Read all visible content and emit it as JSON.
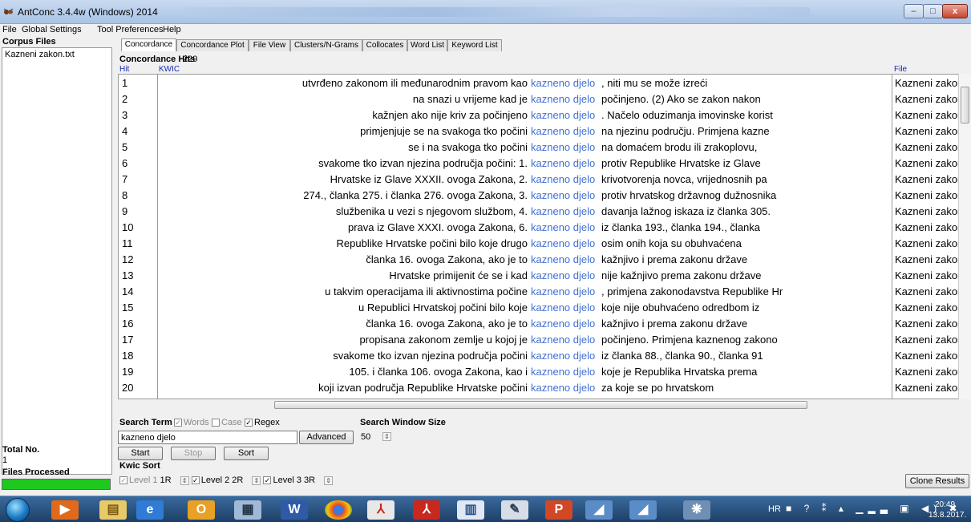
{
  "window": {
    "title": "AntConc 3.4.4w (Windows) 2014",
    "minimize": "–",
    "maximize": "□",
    "close": "x"
  },
  "menu": [
    "File",
    "Global Settings",
    "Tool Preferences",
    "Help"
  ],
  "left_panel": {
    "corpus_title": "Corpus Files",
    "files": [
      "Kazneni zakon.txt"
    ],
    "total_label": "Total No.",
    "total_value": "1",
    "files_processed_label": "Files Processed",
    "progress": 1.0
  },
  "tabs": [
    "Concordance",
    "Concordance Plot",
    "File View",
    "Clusters/N-Grams",
    "Collocates",
    "Word List",
    "Keyword List"
  ],
  "active_tab": "Concordance",
  "hits": {
    "label": "Concordance Hits",
    "count": "229"
  },
  "columns": {
    "hit": "Hit",
    "kwic": "KWIC",
    "file": "File"
  },
  "rows": [
    {
      "hit": "1",
      "left": "utvrđeno zakonom ili međunarodnim pravom kao",
      "kw": "kazneno djelo",
      "right": ", niti mu se može izreći",
      "file": "Kazneni zakon"
    },
    {
      "hit": "2",
      "left": "na snazi u vrijeme kad je",
      "kw": "kazneno djelo",
      "right": " počinjeno. (2) Ako se zakon nakon",
      "file": "Kazneni zakon"
    },
    {
      "hit": "3",
      "left": "kažnjen ako nije kriv za počinjeno",
      "kw": "kazneno djelo",
      "right": ".  Načelo oduzimanja imovinske korist",
      "file": "Kazneni zakon"
    },
    {
      "hit": "4",
      "left": "primjenjuje se na svakoga tko počini",
      "kw": "kazneno djelo",
      "right": " na njezinu području.  Primjena kazne",
      "file": "Kazneni zakon"
    },
    {
      "hit": "5",
      "left": "se i na svakoga tko počini",
      "kw": "kazneno djelo",
      "right": " na domaćem brodu ili zrakoplovu,",
      "file": "Kazneni zakon"
    },
    {
      "hit": "6",
      "left": "svakome tko izvan njezina područja počini: 1.",
      "kw": "kazneno djelo",
      "right": " protiv Republike Hrvatske iz Glave",
      "file": "Kazneni zakon"
    },
    {
      "hit": "7",
      "left": "Hrvatske iz Glave XXXII. ovoga Zakona, 2.",
      "kw": "kazneno djelo",
      "right": " krivotvorenja novca, vrijednosnih pa",
      "file": "Kazneni zakon"
    },
    {
      "hit": "8",
      "left": "274., članka 275. i članka 276. ovoga Zakona, 3.",
      "kw": "kazneno djelo",
      "right": " protiv hrvatskog državnog dužnosnika",
      "file": "Kazneni zakon"
    },
    {
      "hit": "9",
      "left": "službenika u vezi s njegovom službom, 4.",
      "kw": "kazneno djelo",
      "right": " davanja lažnog iskaza iz članka 305.",
      "file": "Kazneni zakon"
    },
    {
      "hit": "10",
      "left": "prava iz Glave XXXI. ovoga Zakona, 6.",
      "kw": "kazneno djelo",
      "right": " iz članka 193., članka 194., članka",
      "file": "Kazneni zakon"
    },
    {
      "hit": "11",
      "left": "Republike Hrvatske počini bilo koje drugo",
      "kw": "kazneno djelo",
      "right": " osim onih koja su obuhvaćena",
      "file": "Kazneni zakon"
    },
    {
      "hit": "12",
      "left": "članka 16. ovoga Zakona, ako je to",
      "kw": "kazneno djelo",
      "right": " kažnjivo i prema zakonu države",
      "file": "Kazneni zakon"
    },
    {
      "hit": "13",
      "left": "Hrvatske primijenit će se i kad",
      "kw": "kazneno djelo",
      "right": " nije kažnjivo prema zakonu države",
      "file": "Kazneni zakon"
    },
    {
      "hit": "14",
      "left": "u takvim operacijama ili aktivnostima počine",
      "kw": "kazneno djelo",
      "right": ", primjena zakonodavstva Republike Hr",
      "file": "Kazneni zakon"
    },
    {
      "hit": "15",
      "left": "u Republici Hrvatskoj počini bilo koje",
      "kw": "kazneno djelo",
      "right": " koje nije obuhvaćeno odredbom iz",
      "file": "Kazneni zakon"
    },
    {
      "hit": "16",
      "left": "članka 16. ovoga Zakona, ako je to",
      "kw": "kazneno djelo",
      "right": " kažnjivo i prema zakonu države",
      "file": "Kazneni zakon"
    },
    {
      "hit": "17",
      "left": "propisana zakonom zemlje u kojoj je",
      "kw": "kazneno djelo",
      "right": " počinjeno.  Primjena kaznenog zakono",
      "file": "Kazneni zakon"
    },
    {
      "hit": "18",
      "left": "svakome tko izvan njezina područja počini",
      "kw": "kazneno djelo",
      "right": " iz članka 88., članka 90., članka 91",
      "file": "Kazneni zakon"
    },
    {
      "hit": "19",
      "left": "105. i članka 106. ovoga Zakona, kao i",
      "kw": "kazneno djelo",
      "right": " koje je Republika Hrvatska prema",
      "file": "Kazneni zakon"
    },
    {
      "hit": "20",
      "left": "koji izvan područja Republike Hrvatske počini",
      "kw": "kazneno djelo",
      "right": " za koje se po hrvatskom",
      "file": "Kazneni zakon"
    }
  ],
  "search": {
    "label": "Search Term",
    "words": "Words",
    "case": "Case",
    "regex": "Regex",
    "words_checked": true,
    "case_checked": false,
    "regex_checked": true,
    "value": "kazneno djelo",
    "advanced": "Advanced",
    "window_label": "Search Window Size",
    "window_value": "50"
  },
  "controls": {
    "start": "Start",
    "stop": "Stop",
    "sort": "Sort",
    "clone": "Clone Results"
  },
  "kwic_sort": {
    "label": "Kwic Sort",
    "level1": "Level 1",
    "level1_value": "1R",
    "level2": "Level 2",
    "level2_value": "2R",
    "level3": "Level 3",
    "level3_value": "3R"
  },
  "taskbar": {
    "lang": "HR",
    "time": "20:49",
    "date": "13.8.2017.",
    "icons": [
      "media-player-icon",
      "file-explorer-icon",
      "internet-explorer-icon",
      "outlook-icon",
      "calculator-icon",
      "word-icon",
      "chrome-icon",
      "pdf-reader-icon",
      "acrobat-icon",
      "spreadsheet-icon",
      "paint-icon",
      "powerpoint-icon",
      "window-icon",
      "window-icon",
      "antconc-icon"
    ]
  }
}
